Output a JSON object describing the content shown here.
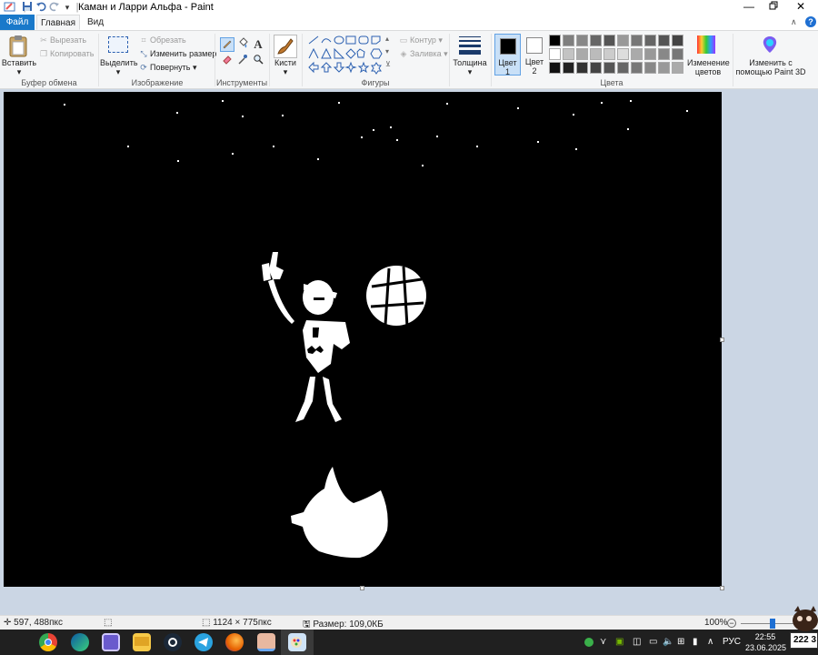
{
  "window": {
    "title": "Каман и Ларри Альфа - Paint",
    "quick_access": [
      "paint-app-icon",
      "save-icon",
      "undo-icon",
      "redo-icon",
      "qat-menu-icon"
    ],
    "controls": [
      "minimize",
      "restore",
      "close"
    ]
  },
  "tabs": [
    {
      "label": "Файл"
    },
    {
      "label": "Главная"
    },
    {
      "label": "Вид"
    }
  ],
  "ribbon": {
    "clipboard": {
      "paste": "Вставить",
      "cut": "Вырезать",
      "copy": "Копировать",
      "label": "Буфер обмена"
    },
    "image": {
      "select": "Выделить",
      "crop": "Обрезать",
      "resize": "Изменить размер",
      "rotate": "Повернуть",
      "label": "Изображение"
    },
    "tools": {
      "label": "Инструменты",
      "items": [
        "pencil-icon",
        "fill-icon",
        "text-icon",
        "eraser-icon",
        "color-picker-icon",
        "magnifier-icon"
      ]
    },
    "brushes": {
      "label": "Кисти"
    },
    "shapes": {
      "label": "Фигуры",
      "outline": "Контур",
      "fill": "Заливка"
    },
    "size": {
      "label": "Толщина"
    },
    "colors": {
      "color1": "Цвет 1",
      "color1_line1": "Цвет",
      "color1_line2": "1",
      "color2_line1": "Цвет",
      "color2_line2": "2",
      "edit_line1": "Изменение",
      "edit_line2": "цветов",
      "label": "Цвета",
      "palette_row1": [
        "#000000",
        "#7f7f7f",
        "#888888",
        "#666666",
        "#555555",
        "#999999",
        "#777777",
        "#666666",
        "#555555",
        "#444444"
      ],
      "palette_row2": [
        "#ffffff",
        "#c3c3c3",
        "#aaaaaa",
        "#bbbbbb",
        "#cccccc",
        "#dddddd",
        "#aaaaaa",
        "#999999",
        "#888888",
        "#777777"
      ],
      "palette_row3": [
        "#111111",
        "#222222",
        "#333333",
        "#444444",
        "#555555",
        "#666666",
        "#777777",
        "#888888",
        "#999999",
        "#aaaaaa"
      ]
    },
    "paint3d": {
      "line1": "Изменить с",
      "line2": "помощью Paint 3D"
    }
  },
  "status": {
    "cursor": "597, 488пкс",
    "dimensions": "1124 × 775пкс",
    "filesize": "Размер: 109,0КБ",
    "zoom": "100%",
    "zoom_level": 1.0
  },
  "taskbar": {
    "apps": [
      "chrome-icon",
      "edge-icon",
      "app-icon",
      "explorer-icon",
      "steam-icon",
      "telegram-icon",
      "firefox-icon",
      "photos-icon",
      "paint-taskbar-icon"
    ],
    "lang": "РУС",
    "time": "22:55",
    "date": "23.06.2025",
    "badge": "222 3"
  }
}
